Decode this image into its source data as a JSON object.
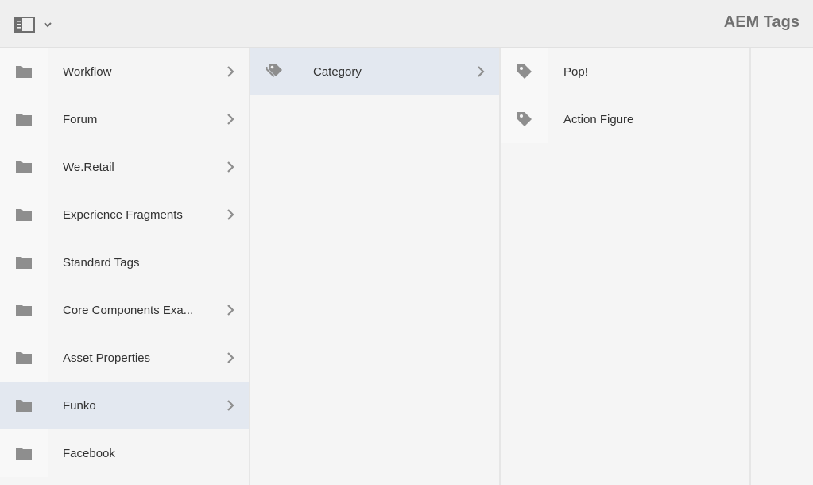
{
  "header": {
    "title": "AEM Tags",
    "rail_toggle_icon": "rail-toggle-icon",
    "dropdown_icon": "chevron-down-icon"
  },
  "columns": {
    "root": [
      {
        "label": "Workflow",
        "has_children": true,
        "selected": false
      },
      {
        "label": "Forum",
        "has_children": true,
        "selected": false
      },
      {
        "label": "We.Retail",
        "has_children": true,
        "selected": false
      },
      {
        "label": "Experience Fragments",
        "has_children": true,
        "selected": false
      },
      {
        "label": "Standard Tags",
        "has_children": false,
        "selected": false
      },
      {
        "label": "Core Components Exa...",
        "has_children": true,
        "selected": false
      },
      {
        "label": "Asset Properties",
        "has_children": true,
        "selected": false
      },
      {
        "label": "Funko",
        "has_children": true,
        "selected": true
      },
      {
        "label": "Facebook",
        "has_children": false,
        "selected": false
      }
    ],
    "funko": [
      {
        "label": "Category",
        "has_children": true,
        "selected": true
      }
    ],
    "category": [
      {
        "label": "Pop!",
        "has_children": false,
        "selected": false
      },
      {
        "label": "Action Figure",
        "has_children": false,
        "selected": false
      }
    ]
  },
  "icons": {
    "namespace": "folder-icon",
    "tag": "tag-icon",
    "expand": "chevron-right-icon"
  },
  "colors": {
    "selected_row": "#e3e8f0",
    "icon_gray": "#8e8e8e",
    "title_gray": "#707070"
  }
}
